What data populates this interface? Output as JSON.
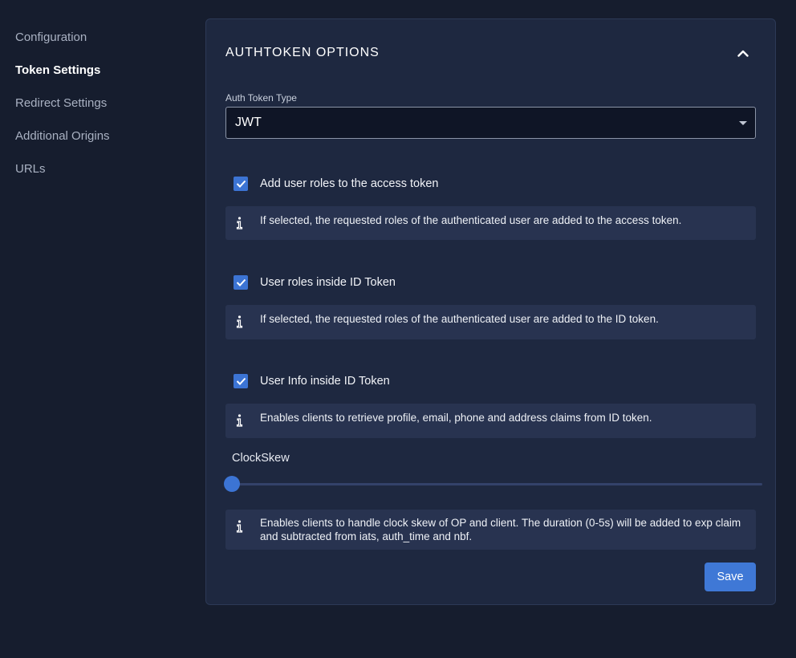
{
  "sidebar": {
    "items": [
      {
        "label": "Configuration",
        "active": false
      },
      {
        "label": "Token Settings",
        "active": true
      },
      {
        "label": "Redirect Settings",
        "active": false
      },
      {
        "label": "Additional Origins",
        "active": false
      },
      {
        "label": "URLs",
        "active": false
      }
    ]
  },
  "card": {
    "title": "AUTHTOKEN OPTIONS",
    "collapse_icon": "chevron-up-icon"
  },
  "auth_token_type": {
    "label": "Auth Token Type",
    "value": "JWT"
  },
  "options": [
    {
      "checked": true,
      "label": "Add user roles to the access token",
      "info": "If selected, the requested roles of the authenticated user are added to the access token."
    },
    {
      "checked": true,
      "label": "User roles inside ID Token",
      "info": "If selected, the requested roles of the authenticated user are added to the ID token."
    },
    {
      "checked": true,
      "label": "User Info inside ID Token",
      "info": "Enables clients to retrieve profile, email, phone and address claims from ID token."
    }
  ],
  "clock_skew": {
    "label": "ClockSkew",
    "value_fraction": 0,
    "info": "Enables clients to handle clock skew of OP and client. The duration (0-5s) will be added to exp claim and subtracted from iats, auth_time and nbf."
  },
  "actions": {
    "save_label": "Save"
  },
  "colors": {
    "background": "#161d2e",
    "card": "#1e2840",
    "accent": "#3c74d4",
    "info_box": "#283350"
  }
}
